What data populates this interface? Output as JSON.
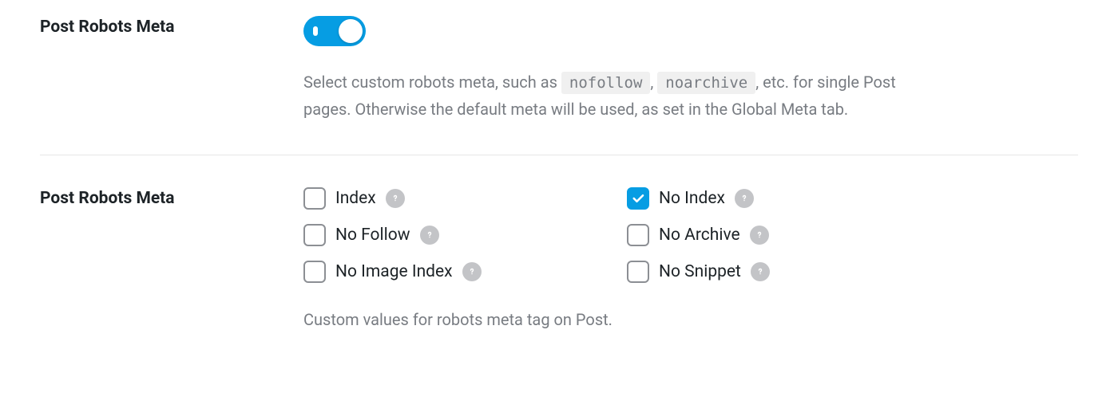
{
  "section1": {
    "label": "Post Robots Meta",
    "toggle_on": true,
    "desc_part1": "Select custom robots meta, such as ",
    "code1": "nofollow",
    "desc_sep1": ", ",
    "code2": "noarchive",
    "desc_part2": ", etc. for single Post pages. Otherwise the default meta will be used, as set in the Global Meta tab."
  },
  "section2": {
    "label": "Post Robots Meta",
    "options": [
      {
        "label": "Index",
        "checked": false
      },
      {
        "label": "No Index",
        "checked": true
      },
      {
        "label": "No Follow",
        "checked": false
      },
      {
        "label": "No Archive",
        "checked": false
      },
      {
        "label": "No Image Index",
        "checked": false
      },
      {
        "label": "No Snippet",
        "checked": false
      }
    ],
    "description": "Custom values for robots meta tag on Post."
  }
}
